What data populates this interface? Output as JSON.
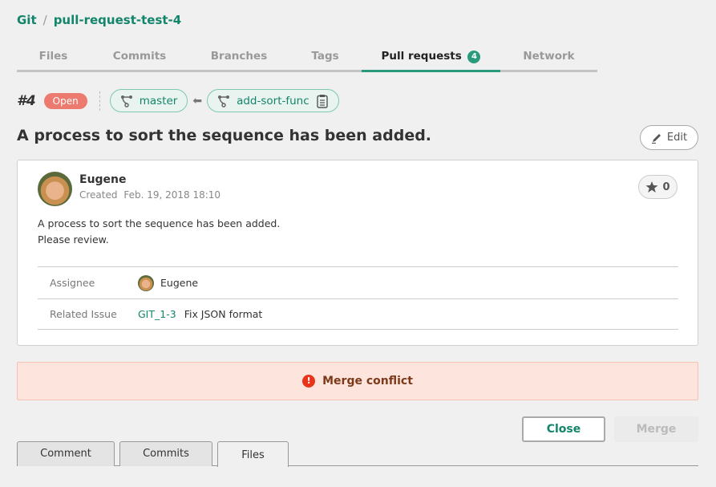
{
  "breadcrumb": {
    "root": "Git",
    "separator": "/",
    "repo": "pull-request-test-4"
  },
  "nav_tabs": [
    {
      "label": "Files",
      "active": false
    },
    {
      "label": "Commits",
      "active": false
    },
    {
      "label": "Branches",
      "active": false
    },
    {
      "label": "Tags",
      "active": false
    },
    {
      "label": "Pull requests",
      "active": true,
      "count": "4"
    },
    {
      "label": "Network",
      "active": false
    }
  ],
  "pull_request": {
    "number": "#4",
    "status": "Open",
    "target_branch": "master",
    "source_branch": "add-sort-func",
    "title": "A process to sort the sequence has been added.",
    "edit_label": "Edit",
    "author": "Eugene",
    "created_label": "Created",
    "created_date": "Feb. 19, 2018 18:10",
    "star_count": "0",
    "body_lines": [
      "A process to sort the sequence has been added.",
      "Please review."
    ],
    "assignee_label": "Assignee",
    "assignee": "Eugene",
    "related_issue_label": "Related Issue",
    "related_issue_id": "GIT_1-3",
    "related_issue_title": "Fix JSON format"
  },
  "alert": {
    "icon": "!",
    "message": "Merge conflict",
    "colors": {
      "bg": "#fde4dd",
      "text": "#7d3a1a",
      "icon": "#e8341a"
    }
  },
  "actions": {
    "close_label": "Close",
    "merge_label": "Merge",
    "merge_disabled": true
  },
  "bottom_tabs": [
    {
      "label": "Comment",
      "active": false
    },
    {
      "label": "Commits",
      "active": false
    },
    {
      "label": "Files",
      "active": true
    }
  ],
  "colors": {
    "accent": "#13856b",
    "tab_active": "#2a9a7c",
    "open_badge": "#ec7a6e"
  }
}
